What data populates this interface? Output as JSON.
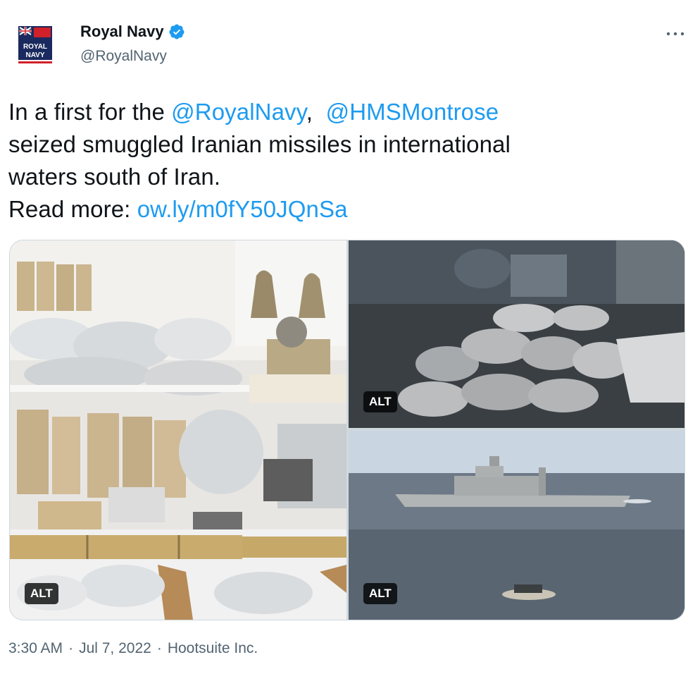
{
  "author": {
    "display_name": "Royal Navy",
    "handle": "@RoyalNavy",
    "verified_icon": "verified-badge-icon",
    "avatar_text_line1": "ROYAL",
    "avatar_text_line2": "NAVY"
  },
  "more_icon": "more-dots-icon",
  "tweet": {
    "t1": "In a first for the ",
    "m1": "@RoyalNavy",
    "t2": ",  ",
    "m2": "@HMSMontrose",
    "t3": "seized smuggled Iranian missiles in international",
    "t4": "waters south of Iran.",
    "t5": "Read more: ",
    "link": "ow.ly/m0fY50JQnSa"
  },
  "media": {
    "alt_labels": [
      "ALT",
      "ALT",
      "ALT"
    ]
  },
  "meta": {
    "time": "3:30 AM",
    "date": "Jul 7, 2022",
    "source": "Hootsuite Inc."
  },
  "colors": {
    "accent": "#1d9bf0",
    "text": "#0f1419",
    "secondary": "#536471",
    "border": "#cfd9de"
  }
}
